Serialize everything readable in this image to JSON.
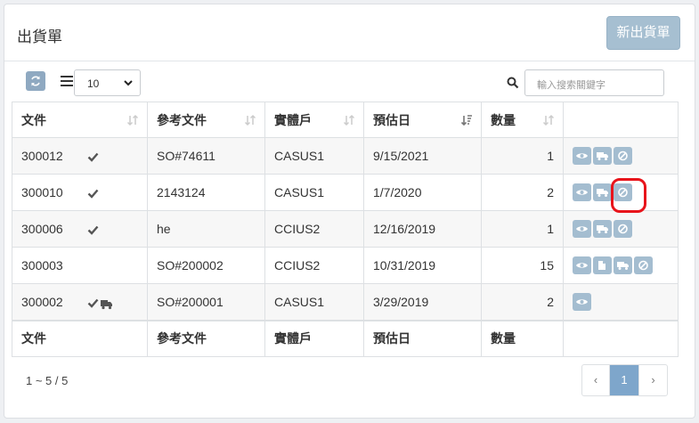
{
  "header": {
    "title": "出貨單",
    "new_button": "新出貨單"
  },
  "toolbar": {
    "page_size": "10",
    "search_placeholder": "輸入搜索關鍵字"
  },
  "table": {
    "columns": [
      "文件",
      "參考文件",
      "實體戶",
      "預估日",
      "數量"
    ],
    "rows": [
      {
        "doc": "300012",
        "ref": "SO#74611",
        "entity": "CASUS1",
        "date": "9/15/2021",
        "qty": "1",
        "status_icons": [
          "check-icon"
        ],
        "actions": [
          "view-icon",
          "truck-icon",
          "cancel-icon"
        ]
      },
      {
        "doc": "300010",
        "ref": "2143124",
        "entity": "CASUS1",
        "date": "1/7/2020",
        "qty": "2",
        "status_icons": [
          "check-icon"
        ],
        "actions": [
          "view-icon",
          "truck-icon",
          "cancel-icon"
        ]
      },
      {
        "doc": "300006",
        "ref": "he",
        "entity": "CCIUS2",
        "date": "12/16/2019",
        "qty": "1",
        "status_icons": [
          "check-icon"
        ],
        "actions": [
          "view-icon",
          "truck-icon",
          "cancel-icon"
        ]
      },
      {
        "doc": "300003",
        "ref": "SO#200002",
        "entity": "CCIUS2",
        "date": "10/31/2019",
        "qty": "15",
        "status_icons": [],
        "actions": [
          "view-icon",
          "copy-icon",
          "truck-icon",
          "cancel-icon"
        ]
      },
      {
        "doc": "300002",
        "ref": "SO#200001",
        "entity": "CASUS1",
        "date": "3/29/2019",
        "qty": "2",
        "status_icons": [
          "check-icon",
          "truck-icon"
        ],
        "actions": [
          "view-icon"
        ]
      }
    ]
  },
  "footer": {
    "info": "1 ~ 5 / 5",
    "prev": "‹",
    "page": "1",
    "next": "›"
  },
  "colors": {
    "accent": "#7ea6cb",
    "action_button": "#a4bdd0",
    "highlight": "#e8141b"
  }
}
